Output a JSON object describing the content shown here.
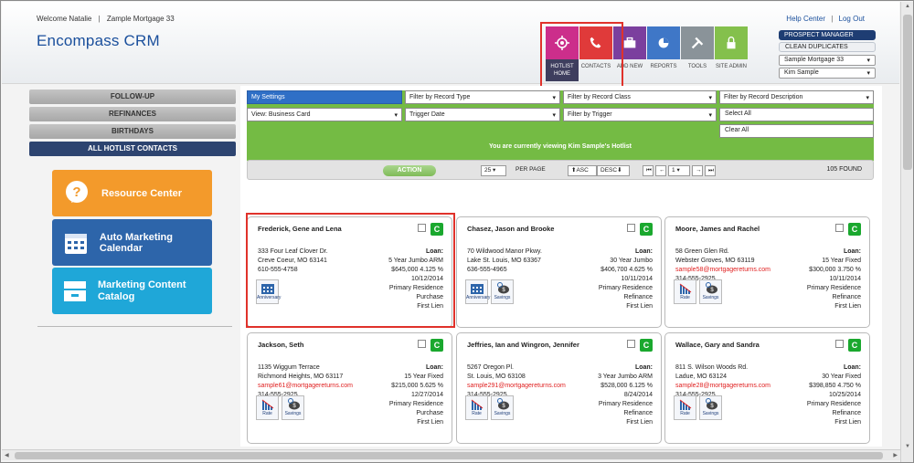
{
  "header": {
    "welcome": "Welcome Natalie",
    "company": "Zample Mortgage 33",
    "help_link": "Help Center",
    "logout_link": "Log Out",
    "logo": "Encompass CRM"
  },
  "nav": [
    {
      "label": "HOTLIST HOME",
      "icon": "hotlist-icon",
      "color": "#cc2e8b"
    },
    {
      "label": "CONTACTS",
      "icon": "phone-icon",
      "color": "#e03a3a"
    },
    {
      "label": "ADD NEW",
      "icon": "briefcase-icon",
      "color": "#7b3f9e"
    },
    {
      "label": "REPORTS",
      "icon": "pie-chart-icon",
      "color": "#3f77c7"
    },
    {
      "label": "TOOLS",
      "icon": "tools-icon",
      "color": "#8a9399"
    },
    {
      "label": "SITE ADMIN",
      "icon": "lock-icon",
      "color": "#84c04c"
    }
  ],
  "right_controls": {
    "prospect_manager": "PROSPECT MANAGER",
    "clean_duplicates": "CLEAN DUPLICATES",
    "company_select": "Sample Mortgage 33",
    "user_select": "Kim Sample"
  },
  "sidebar": {
    "buttons": [
      "FOLLOW-UP",
      "REFINANCES",
      "BIRTHDAYS",
      "ALL HOTLIST CONTACTS"
    ],
    "resource_center": "Resource Center",
    "auto_marketing": "Auto Marketing Calendar",
    "marketing_content": "Marketing Content Catalog"
  },
  "filters": {
    "my_settings": "My Settings",
    "record_type": "Filter by Record Type",
    "record_class": "Filter by Record Class",
    "record_description": "Filter by Record Description",
    "view": "View: Business Card",
    "trigger_date": "Trigger Date",
    "by_trigger": "Filter by Trigger",
    "select_all": "Select All",
    "clear_all": "Clear All",
    "viewing_msg": "You are currently viewing Kim Sample's Hotlist"
  },
  "toolbar": {
    "action": "ACTION",
    "per_page_value": "25",
    "per_page_label": "PER PAGE",
    "asc": "ASC",
    "desc": "DESC",
    "page": "1",
    "found": "105 FOUND"
  },
  "contacts": [
    {
      "name": "Frederick, Gene and Lena",
      "addr1": "333 Four Leaf Clover Dr.",
      "addr2": "Creve Coeur, MO 63141",
      "email": "",
      "phone": "610-555-4758",
      "loan_label": "Loan:",
      "loan_type": "5 Year Jumbo ARM",
      "amount_rate": "$645,000   4.125 %",
      "date": "10/12/2014",
      "residence": "Primary Residence",
      "purpose": "Purchase",
      "lien": "First Lien",
      "icons": [
        "Anniversary"
      ]
    },
    {
      "name": "Chasez, Jason and Brooke",
      "addr1": "70 Wildwood Manor Pkwy.",
      "addr2": "Lake St. Louis, MO 63367",
      "email": "",
      "phone": "636-555-4965",
      "loan_label": "Loan:",
      "loan_type": "30 Year Jumbo",
      "amount_rate": "$406,700   4.625 %",
      "date": "10/11/2014",
      "residence": "Primary Residence",
      "purpose": "Refinance",
      "lien": "First Lien",
      "icons": [
        "Anniversary",
        "Savings"
      ]
    },
    {
      "name": "Moore, James and Rachel",
      "addr1": "58 Green Glen Rd.",
      "addr2": "Webster Groves, MO 63119",
      "email": "sample58@mortgagereturns.com",
      "phone": "314-555-2925",
      "loan_label": "Loan:",
      "loan_type": "15 Year Fixed",
      "amount_rate": "$300,000   3.750 %",
      "date": "10/11/2014",
      "residence": "Primary Residence",
      "purpose": "Refinance",
      "lien": "First Lien",
      "icons": [
        "Rate",
        "Savings"
      ]
    },
    {
      "name": "Jackson, Seth",
      "addr1": "1135 Wiggum Terrace",
      "addr2": "Richmond Heights, MO 63117",
      "email": "sample61@mortgagereturns.com",
      "phone": "314-555-2925",
      "loan_label": "Loan:",
      "loan_type": "15 Year Fixed",
      "amount_rate": "$215,000   5.625 %",
      "date": "12/27/2014",
      "residence": "Primary Residence",
      "purpose": "Purchase",
      "lien": "First Lien",
      "icons": [
        "Rate",
        "Savings"
      ]
    },
    {
      "name": "Jeffries, Ian and Wingron, Jennifer",
      "addr1": "5267 Oregon Pl.",
      "addr2": "St. Louis, MO 63108",
      "email": "sample291@mortgagereturns.com",
      "phone": "314-555-2925",
      "loan_label": "Loan:",
      "loan_type": "3 Year Jumbo ARM",
      "amount_rate": "$528,000   6.125 %",
      "date": "8/24/2014",
      "residence": "Primary Residence",
      "purpose": "Refinance",
      "lien": "First Lien",
      "icons": [
        "Rate",
        "Savings"
      ]
    },
    {
      "name": "Wallace, Gary and Sandra",
      "addr1": "811 S. Wilson Woods Rd.",
      "addr2": "Ladue, MO 63124",
      "email": "sample28@mortgagereturns.com",
      "phone": "314-555-2925",
      "loan_label": "Loan:",
      "loan_type": "30 Year Fixed",
      "amount_rate": "$398,850   4.750 %",
      "date": "10/25/2014",
      "residence": "Primary Residence",
      "purpose": "Refinance",
      "lien": "First Lien",
      "icons": [
        "Rate",
        "Savings"
      ]
    }
  ],
  "colors": {
    "accent": "#1a4f9c",
    "green": "#74bb44",
    "highlight": "#e0322b",
    "email": "#e02020"
  }
}
